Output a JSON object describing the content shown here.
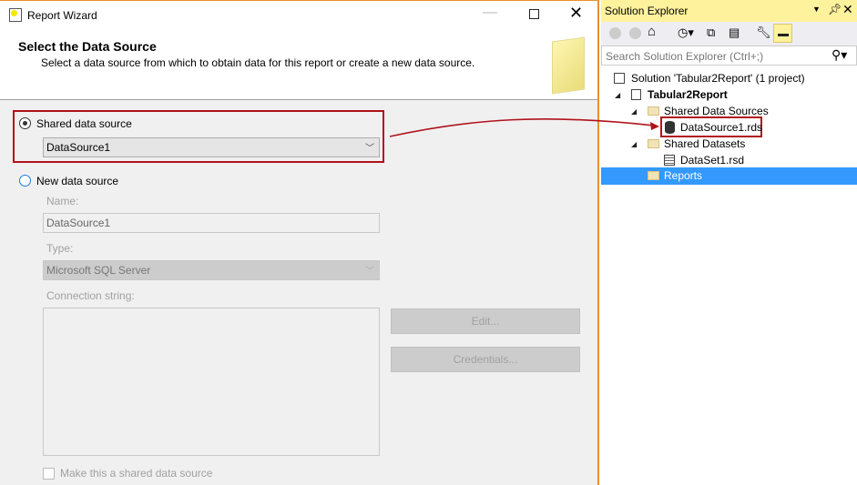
{
  "wizard": {
    "title": "Report Wizard",
    "heading": "Select the Data Source",
    "subheading": "Select a data source from which to obtain data for this report or create a new data source.",
    "shared_option": "Shared data source",
    "shared_selected": "DataSource1",
    "new_option": "New data source",
    "name_label": "Name:",
    "name_value": "DataSource1",
    "type_label": "Type:",
    "type_value": "Microsoft SQL Server",
    "conn_label": "Connection string:",
    "conn_value": "",
    "edit_button": "Edit...",
    "credentials_button": "Credentials...",
    "make_shared_label": "Make this a shared data source"
  },
  "solution_explorer": {
    "title": "Solution Explorer",
    "search_placeholder": "Search Solution Explorer (Ctrl+;)",
    "tree": {
      "solution": "Solution 'Tabular2Report' (1 project)",
      "project": "Tabular2Report",
      "shared_data_sources": "Shared Data Sources",
      "datasource_file": "DataSource1.rds",
      "shared_datasets": "Shared Datasets",
      "dataset_file": "DataSet1.rsd",
      "reports": "Reports"
    }
  },
  "colors": {
    "accent": "#e8912b",
    "highlight": "#3399ff",
    "annotation": "#b0121b",
    "se_title_bg": "#fff29d"
  }
}
